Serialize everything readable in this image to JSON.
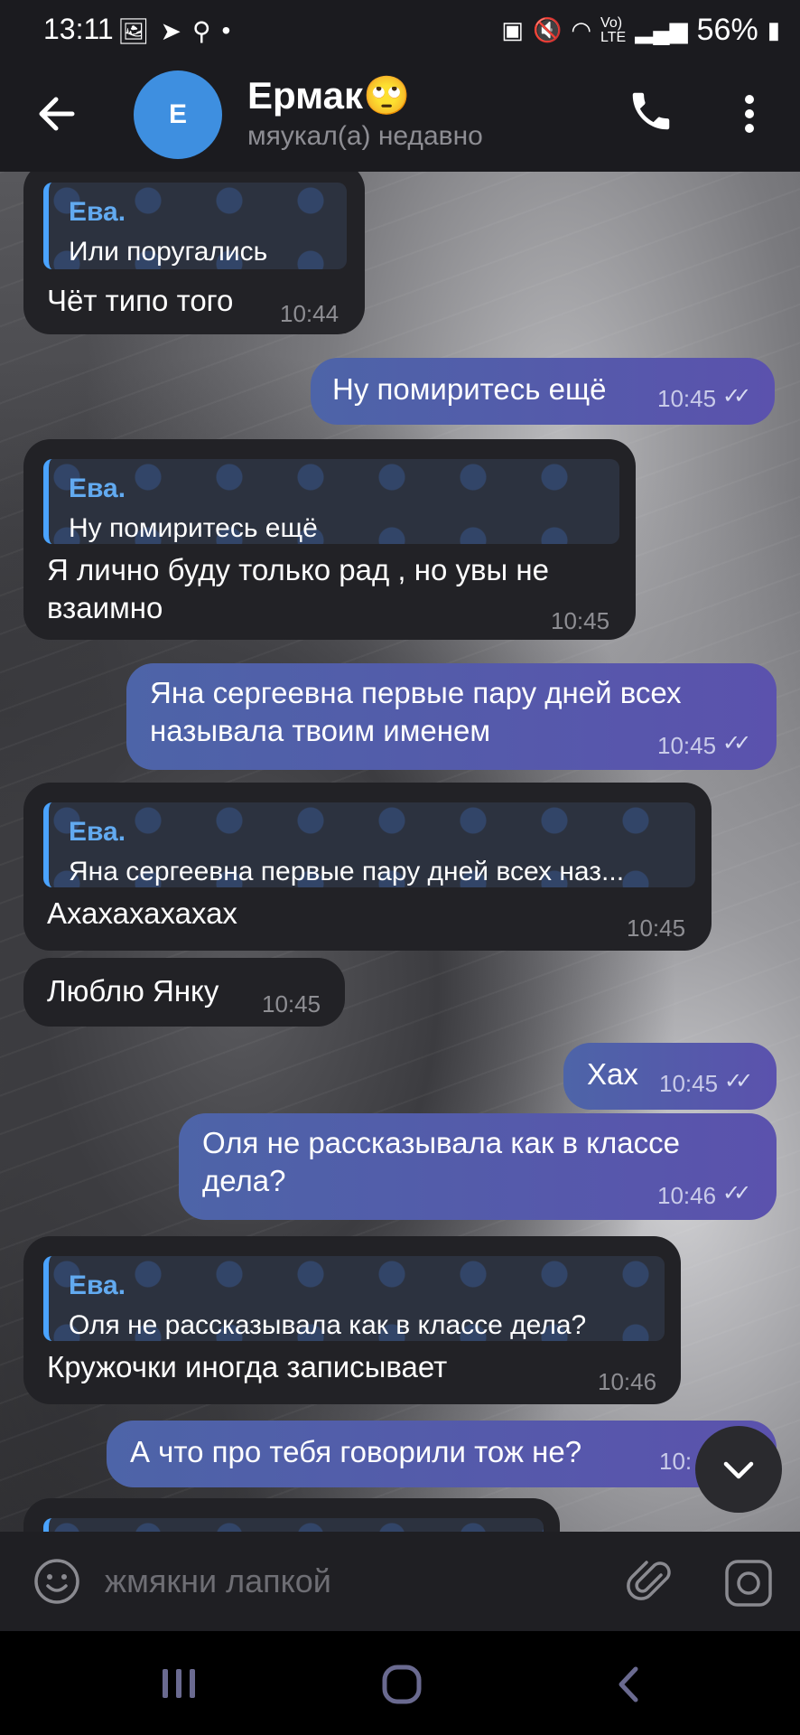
{
  "status_bar": {
    "time": "13:11",
    "battery": "56%",
    "icons": [
      "image-icon",
      "telegram-icon",
      "search-icon",
      "dot-icon"
    ],
    "right_icons": [
      "alarm-icon",
      "mute-icon",
      "wifi-icon",
      "volte-icon",
      "signal-icon",
      "battery-icon"
    ]
  },
  "header": {
    "avatar_letter": "E",
    "name": "Ермак🙄",
    "status": "мяукал(а) недавно"
  },
  "messages": [
    {
      "dir": "in",
      "reply_name": "Ева.",
      "reply_text": "Или поругались",
      "text": "Чёт типо того",
      "time": "10:44"
    },
    {
      "dir": "out",
      "text": "Ну помиритесь ещё",
      "time": "10:45"
    },
    {
      "dir": "in",
      "reply_name": "Ева.",
      "reply_text": "Ну помиритесь ещё",
      "text_lines": [
        "Я лично буду только рад , но увы не",
        "взаимно"
      ],
      "time": "10:45"
    },
    {
      "dir": "out",
      "text_lines": [
        "Яна сергеевна первые пару дней всех",
        "называла твоим именем"
      ],
      "time": "10:45"
    },
    {
      "dir": "in",
      "reply_name": "Ева.",
      "reply_text": "Яна сергеевна первые пару дней всех наз...",
      "text": "Ахахахахахах",
      "time": "10:45"
    },
    {
      "dir": "in",
      "text": "Люблю Янку",
      "time": "10:45"
    },
    {
      "dir": "out",
      "text": "Хах",
      "time": "10:45"
    },
    {
      "dir": "out",
      "text_lines": [
        "Оля не рассказывала как в классе",
        "дела?"
      ],
      "time": "10:46"
    },
    {
      "dir": "in",
      "reply_name": "Ева.",
      "reply_text": "Оля не рассказывала как в классе дела?",
      "text": "Кружочки иногда записывает",
      "time": "10:46"
    },
    {
      "dir": "out",
      "text": "А что про тебя говорили тож не?",
      "time": "10:"
    }
  ],
  "input": {
    "placeholder": "жмякни лапкой"
  }
}
